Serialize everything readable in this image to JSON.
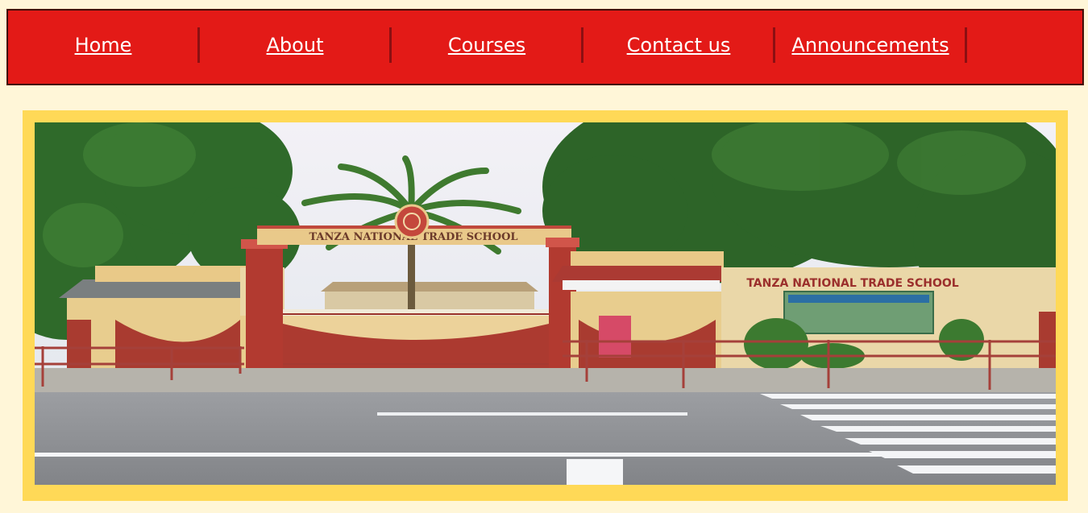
{
  "nav": {
    "items": [
      {
        "label": "Home"
      },
      {
        "label": "About"
      },
      {
        "label": "Courses"
      },
      {
        "label": "Contact us"
      },
      {
        "label": "Announcements"
      }
    ]
  },
  "hero": {
    "gate_arch_text": "TANZA NATIONAL TRADE SCHOOL",
    "wall_sign_text": "TANZA NATIONAL TRADE SCHOOL",
    "colors": {
      "nav_bg": "#e31a17",
      "frame": "#ffd957",
      "page_bg": "#fff6d8"
    }
  }
}
